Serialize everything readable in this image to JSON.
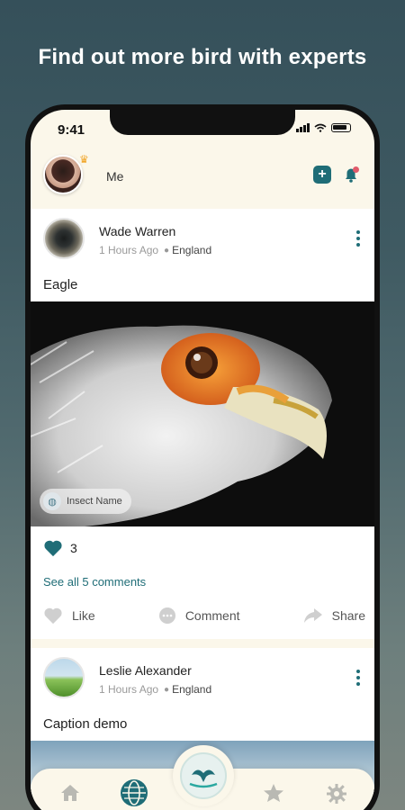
{
  "headline": "Find out more bird with experts",
  "status": {
    "time": "9:41"
  },
  "topbar": {
    "me_label": "Me",
    "add_icon": "plus-square-icon",
    "bell_icon": "notification-bell-icon"
  },
  "posts": [
    {
      "author": "Wade Warren",
      "time_ago": "1 Hours Ago",
      "location": "England",
      "caption": "Eagle",
      "image_chip": "Insect Name",
      "likes": "3",
      "see_all_comments": "See all 5 comments",
      "actions": {
        "like": "Like",
        "comment": "Comment",
        "share": "Share"
      }
    },
    {
      "author": "Leslie Alexander",
      "time_ago": "1 Hours Ago",
      "location": "England",
      "caption": "Caption demo"
    }
  ],
  "colors": {
    "accent": "#1f6d77",
    "background": "#fbf7ea"
  },
  "bottom_nav": {
    "items": [
      "home-icon",
      "globe-icon",
      "bird-scan-icon",
      "star-icon",
      "gear-icon"
    ]
  }
}
